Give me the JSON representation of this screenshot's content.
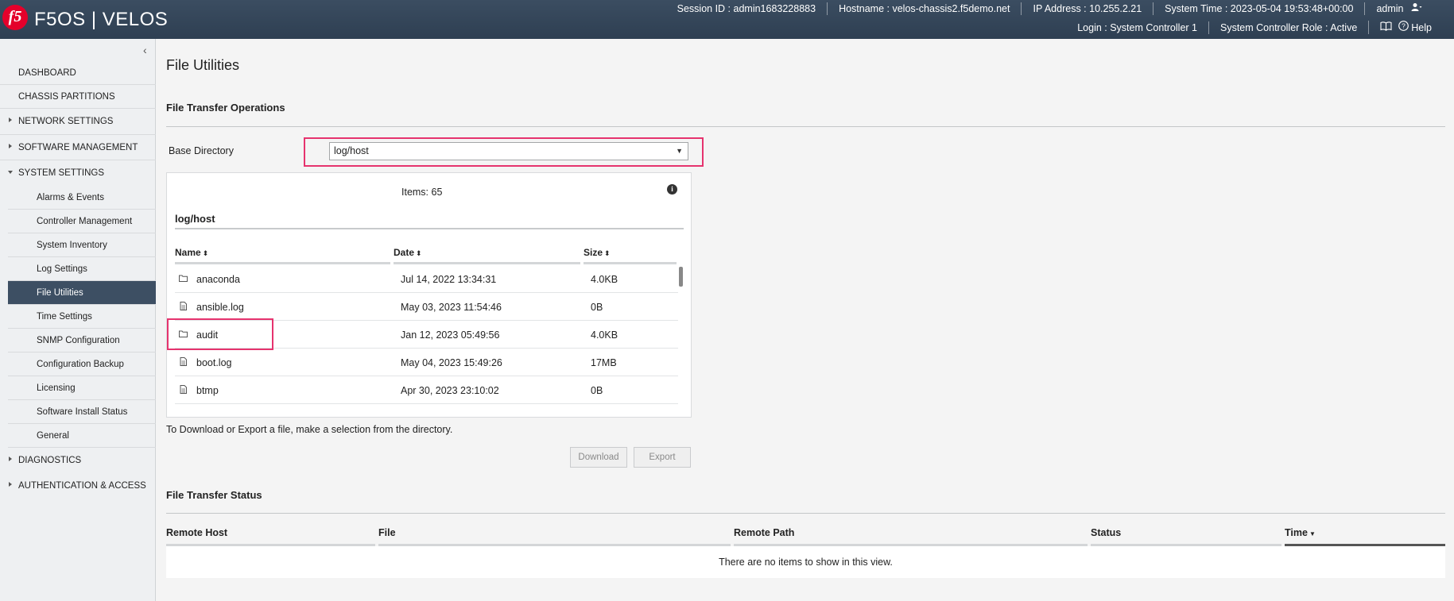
{
  "header": {
    "logo_text": "f5",
    "brand": "F5OS | VELOS",
    "session": "Session ID : admin1683228883",
    "hostname": "Hostname : velos-chassis2.f5demo.net",
    "ip": "IP Address : 10.255.2.21",
    "system_time": "System Time : 2023-05-04 19:53:48+00:00",
    "user": "admin",
    "login": "Login : System Controller 1",
    "role": "System Controller Role : Active",
    "help": "Help"
  },
  "sidebar": {
    "collapse_icon": "chevron-left-icon",
    "items": [
      {
        "label": "DASHBOARD"
      },
      {
        "label": "CHASSIS PARTITIONS"
      },
      {
        "label": "NETWORK SETTINGS"
      },
      {
        "label": "SOFTWARE MANAGEMENT"
      },
      {
        "label": "SYSTEM SETTINGS"
      }
    ],
    "sub_items": [
      {
        "label": "Alarms & Events"
      },
      {
        "label": "Controller Management"
      },
      {
        "label": "System Inventory"
      },
      {
        "label": "Log Settings"
      },
      {
        "label": "File Utilities"
      },
      {
        "label": "Time Settings"
      },
      {
        "label": "SNMP Configuration"
      },
      {
        "label": "Configuration Backup"
      },
      {
        "label": "Licensing"
      },
      {
        "label": "Software Install Status"
      },
      {
        "label": "General"
      }
    ],
    "bottom_items": [
      {
        "label": "DIAGNOSTICS"
      },
      {
        "label": "AUTHENTICATION & ACCESS"
      }
    ]
  },
  "main": {
    "title": "File Utilities",
    "transfer_ops_title": "File Transfer Operations",
    "base_dir_label": "Base Directory",
    "base_dir_value": "log/host",
    "items_count": "Items: 65",
    "dir_label": "log/host",
    "columns": {
      "name": "Name",
      "date": "Date",
      "size": "Size"
    },
    "files": [
      {
        "name": "anaconda",
        "date": "Jul 14, 2022 13:34:31",
        "size": "4.0KB",
        "icon": "folder-icon"
      },
      {
        "name": "ansible.log",
        "date": "May 03, 2023 11:54:46",
        "size": "0B",
        "icon": "file-icon"
      },
      {
        "name": "audit",
        "date": "Jan 12, 2023 05:49:56",
        "size": "4.0KB",
        "icon": "folder-icon"
      },
      {
        "name": "boot.log",
        "date": "May 04, 2023 15:49:26",
        "size": "17MB",
        "icon": "file-icon"
      },
      {
        "name": "btmp",
        "date": "Apr 30, 2023 23:10:02",
        "size": "0B",
        "icon": "file-icon"
      }
    ],
    "hint": "To Download or Export a file, make a selection from the directory.",
    "download_label": "Download",
    "export_label": "Export",
    "status_title": "File Transfer Status",
    "status_columns": {
      "remote_host": "Remote Host",
      "file": "File",
      "remote_path": "Remote Path",
      "status": "Status",
      "time": "Time"
    },
    "empty_text": "There are no items to show in this view."
  },
  "colors": {
    "header_bg": "#33455a",
    "highlight": "#e6336e",
    "active_nav": "#3d4f63",
    "logo_red": "#e4002b"
  }
}
